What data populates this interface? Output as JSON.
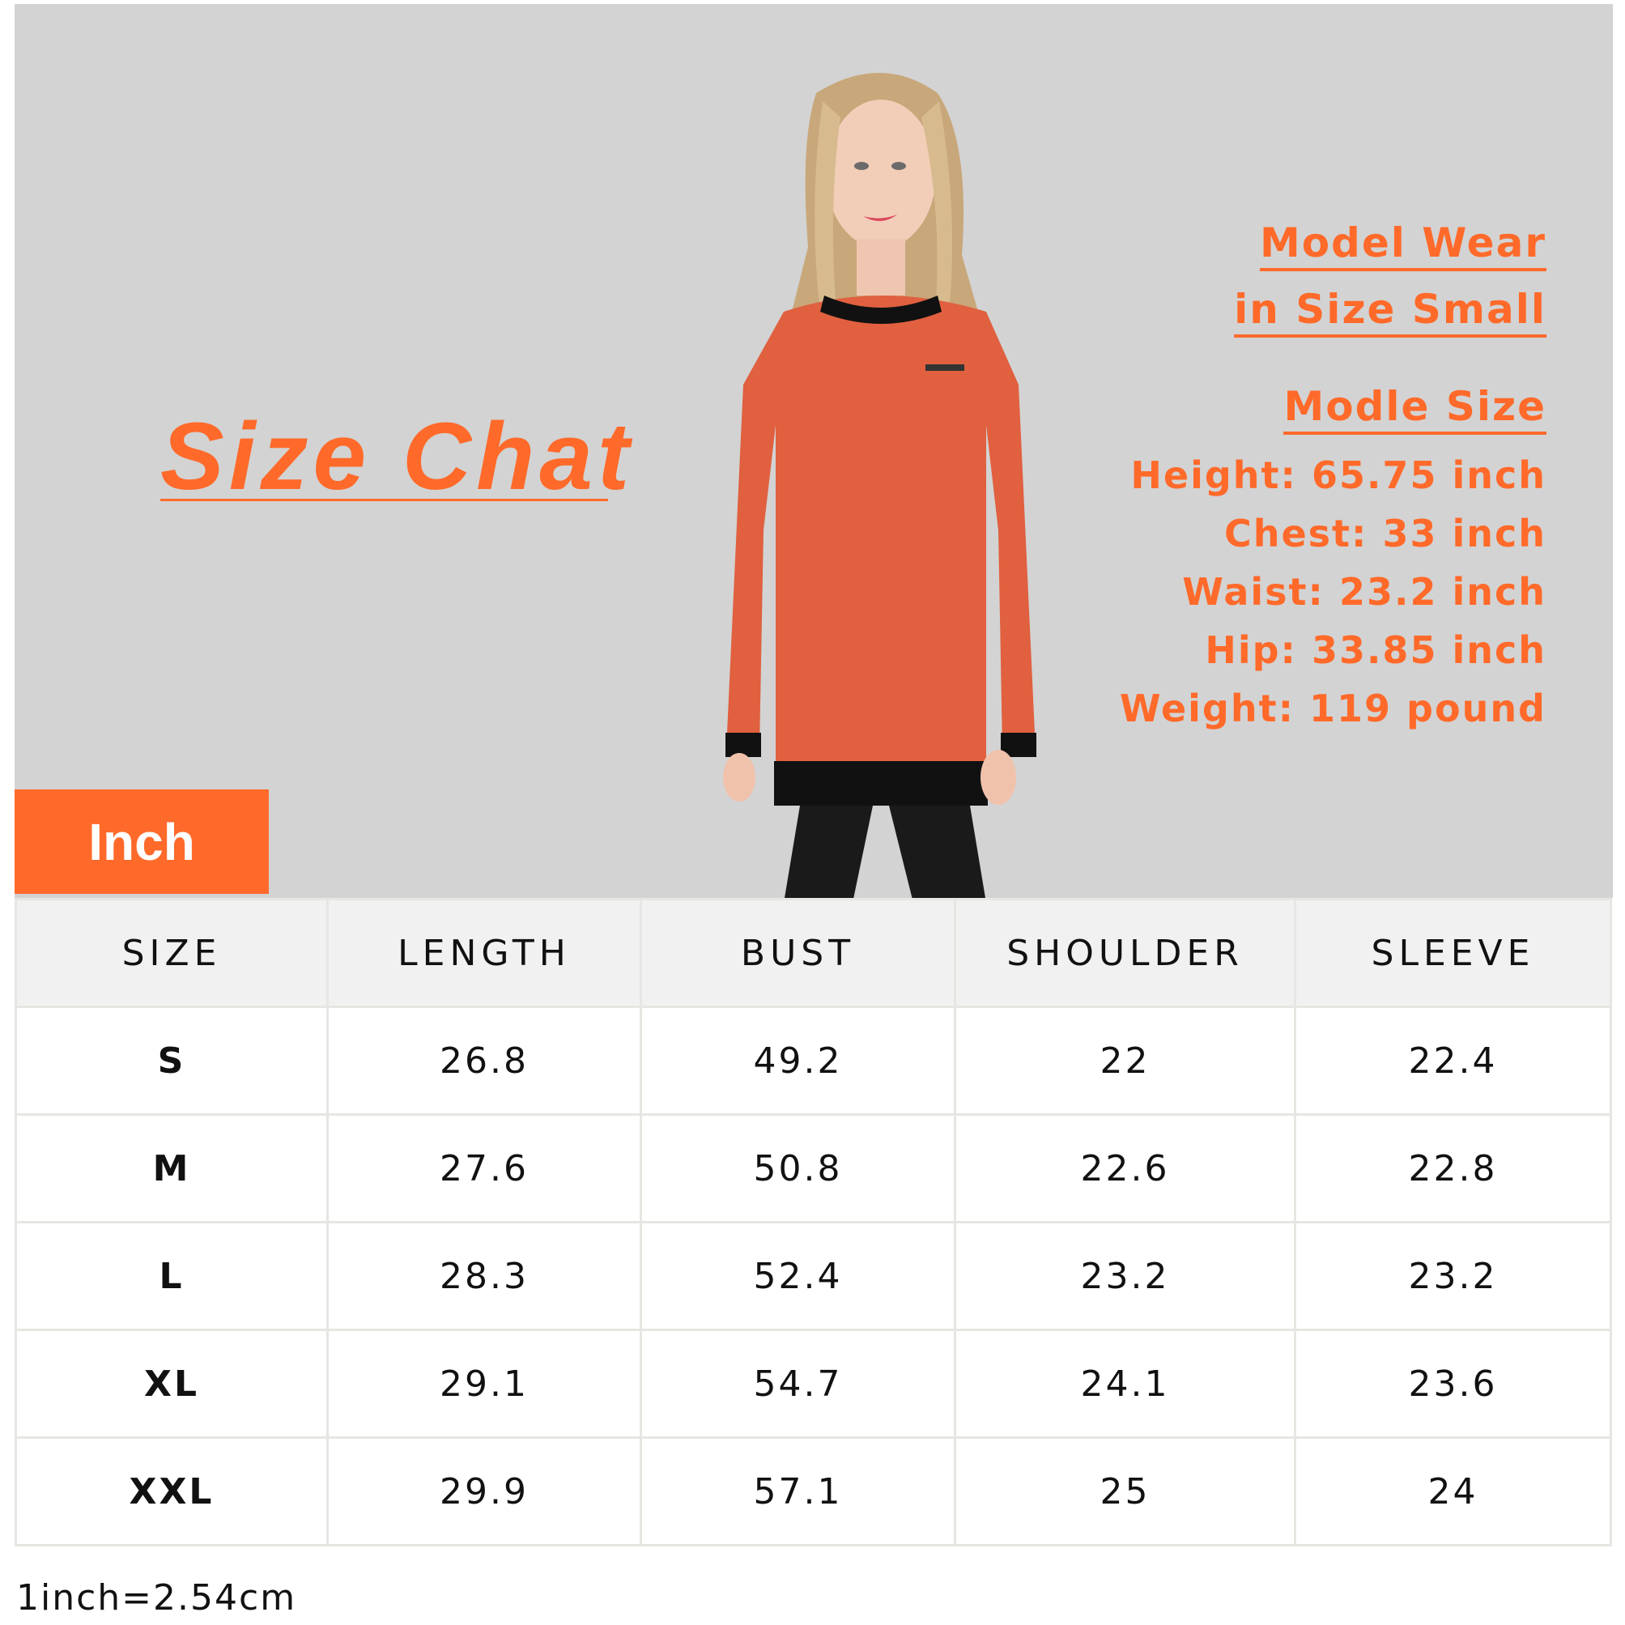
{
  "title": "Size Chat",
  "model_wear": {
    "line1": "Model Wear",
    "line2": "in Size Small"
  },
  "model_size": {
    "heading": "Modle Size",
    "stats": [
      "Height: 65.75 inch",
      "Chest: 33 inch",
      "Waist: 23.2 inch",
      "Hip: 33.85 inch",
      "Weight: 119 pound"
    ]
  },
  "unit_tab": "Inch",
  "table": {
    "headers": [
      "SIZE",
      "LENGTH",
      "BUST",
      "SHOULDER",
      "SLEEVE"
    ],
    "rows": [
      [
        "S",
        "26.8",
        "49.2",
        "22",
        "22.4"
      ],
      [
        "M",
        "27.6",
        "50.8",
        "22.6",
        "22.8"
      ],
      [
        "L",
        "28.3",
        "52.4",
        "23.2",
        "23.2"
      ],
      [
        "XL",
        "29.1",
        "54.7",
        "24.1",
        "23.6"
      ],
      [
        "XXL",
        "29.9",
        "57.1",
        "25",
        "24"
      ]
    ]
  },
  "footnote": "1inch=2.54cm",
  "colors": {
    "accent": "#ff6a2a",
    "background_panel": "#d3d3d3",
    "sweater": "#e0603f",
    "header_row": "#f1f1f1"
  }
}
